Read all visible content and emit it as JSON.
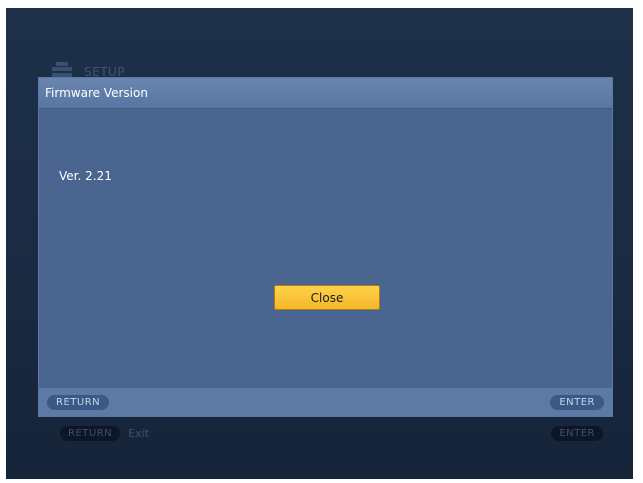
{
  "background": {
    "section_title": "SETUP",
    "section_icon": "setup-icon",
    "footer": {
      "return_label": "RETURN",
      "return_text": "Exit",
      "enter_label": "ENTER"
    }
  },
  "dialog": {
    "title": "Firmware Version",
    "version": "Ver. 2.21",
    "close_label": "Close",
    "footer": {
      "return_label": "RETURN",
      "enter_label": "ENTER"
    }
  },
  "colors": {
    "dialog_bg": "#4a6690",
    "titlebar": "#5f7ca8",
    "button_accent": "#f5b72a",
    "screen_bg": "#1c2d45"
  }
}
